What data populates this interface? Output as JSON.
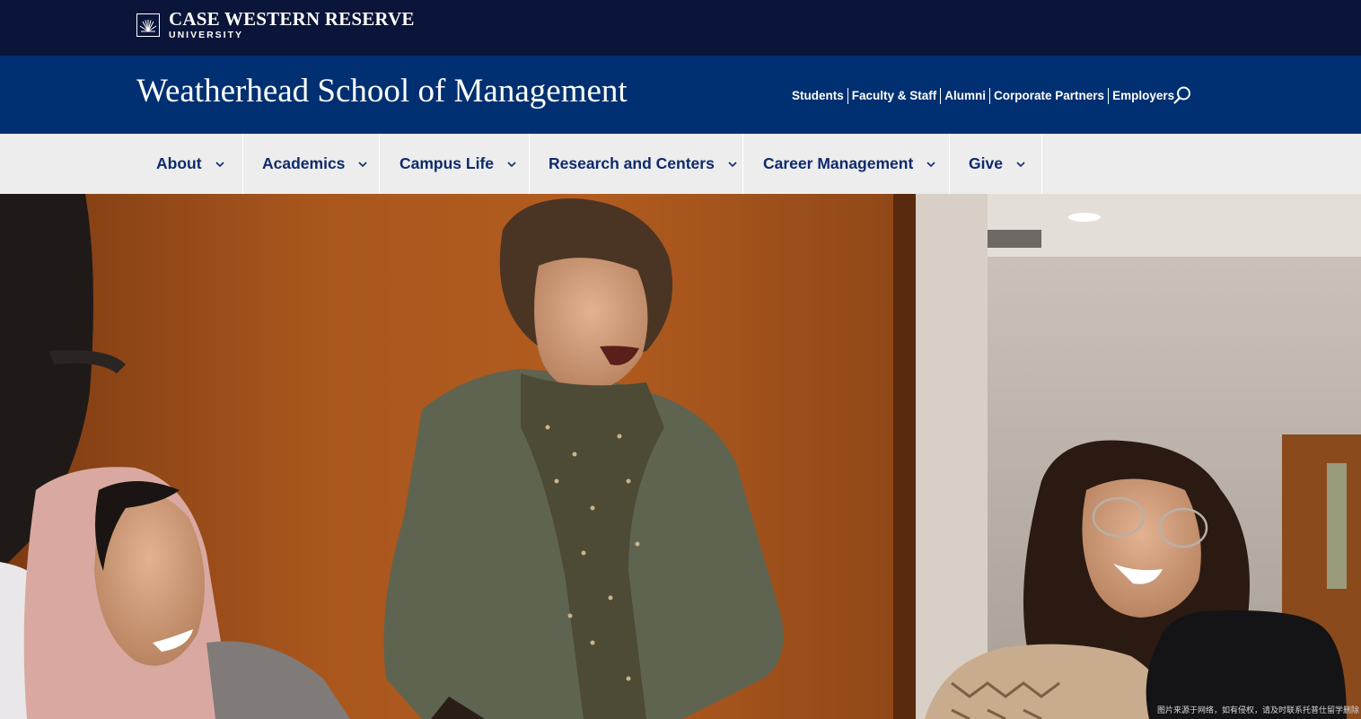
{
  "university": {
    "name": "CASE WESTERN RESERVE",
    "sub": "UNIVERSITY"
  },
  "school": {
    "title": "Weatherhead School of Management"
  },
  "audience_links": [
    "Students",
    "Faculty & Staff",
    "Alumni",
    "Corporate Partners",
    "Employers"
  ],
  "search": {
    "icon": "search-icon"
  },
  "nav": {
    "items": [
      {
        "label": "About"
      },
      {
        "label": "Academics"
      },
      {
        "label": "Campus Life"
      },
      {
        "label": "Research and Centers"
      },
      {
        "label": "Career Management"
      },
      {
        "label": "Give"
      }
    ],
    "icon": "chevron-down-icon"
  },
  "hero": {
    "watermark": "图片来源于网络，如有侵权，请及时联系托普仕留学删除"
  },
  "colors": {
    "topbar": "#0a1539",
    "school_bar": "#003071",
    "nav_bg": "#ededed",
    "nav_text": "#0e2a6b"
  }
}
